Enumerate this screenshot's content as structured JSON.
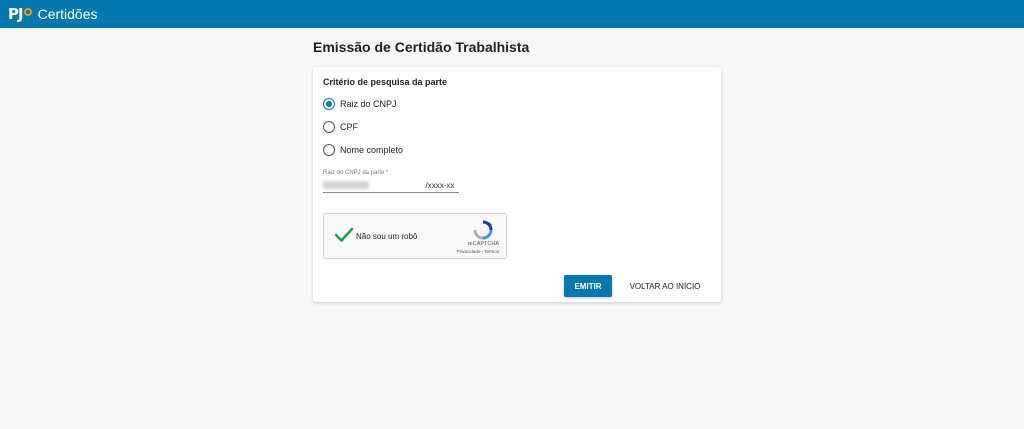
{
  "header": {
    "logo_text": "PJ",
    "app_title": "Certidões",
    "bar_color": "#0278ae"
  },
  "page": {
    "title": "Emissão de Certidão Trabalhista"
  },
  "form": {
    "section_title": "Critério de pesquisa da parte",
    "options": [
      {
        "label": "Raiz do CNPJ",
        "checked": true
      },
      {
        "label": "CPF",
        "checked": false
      },
      {
        "label": "Nome completo",
        "checked": false
      }
    ],
    "field_label": "Raiz do CNPJ da parte *",
    "field_suffix": "/xxxx-xx"
  },
  "recaptcha": {
    "label": "Não sou um robô",
    "brand": "reCAPTCHA",
    "links": "Privacidade - Termos",
    "checked": true
  },
  "actions": {
    "emitir_label": "EMITIR",
    "voltar_label": "VOLTAR AO INÍCIO",
    "accent": "#0278ae"
  }
}
